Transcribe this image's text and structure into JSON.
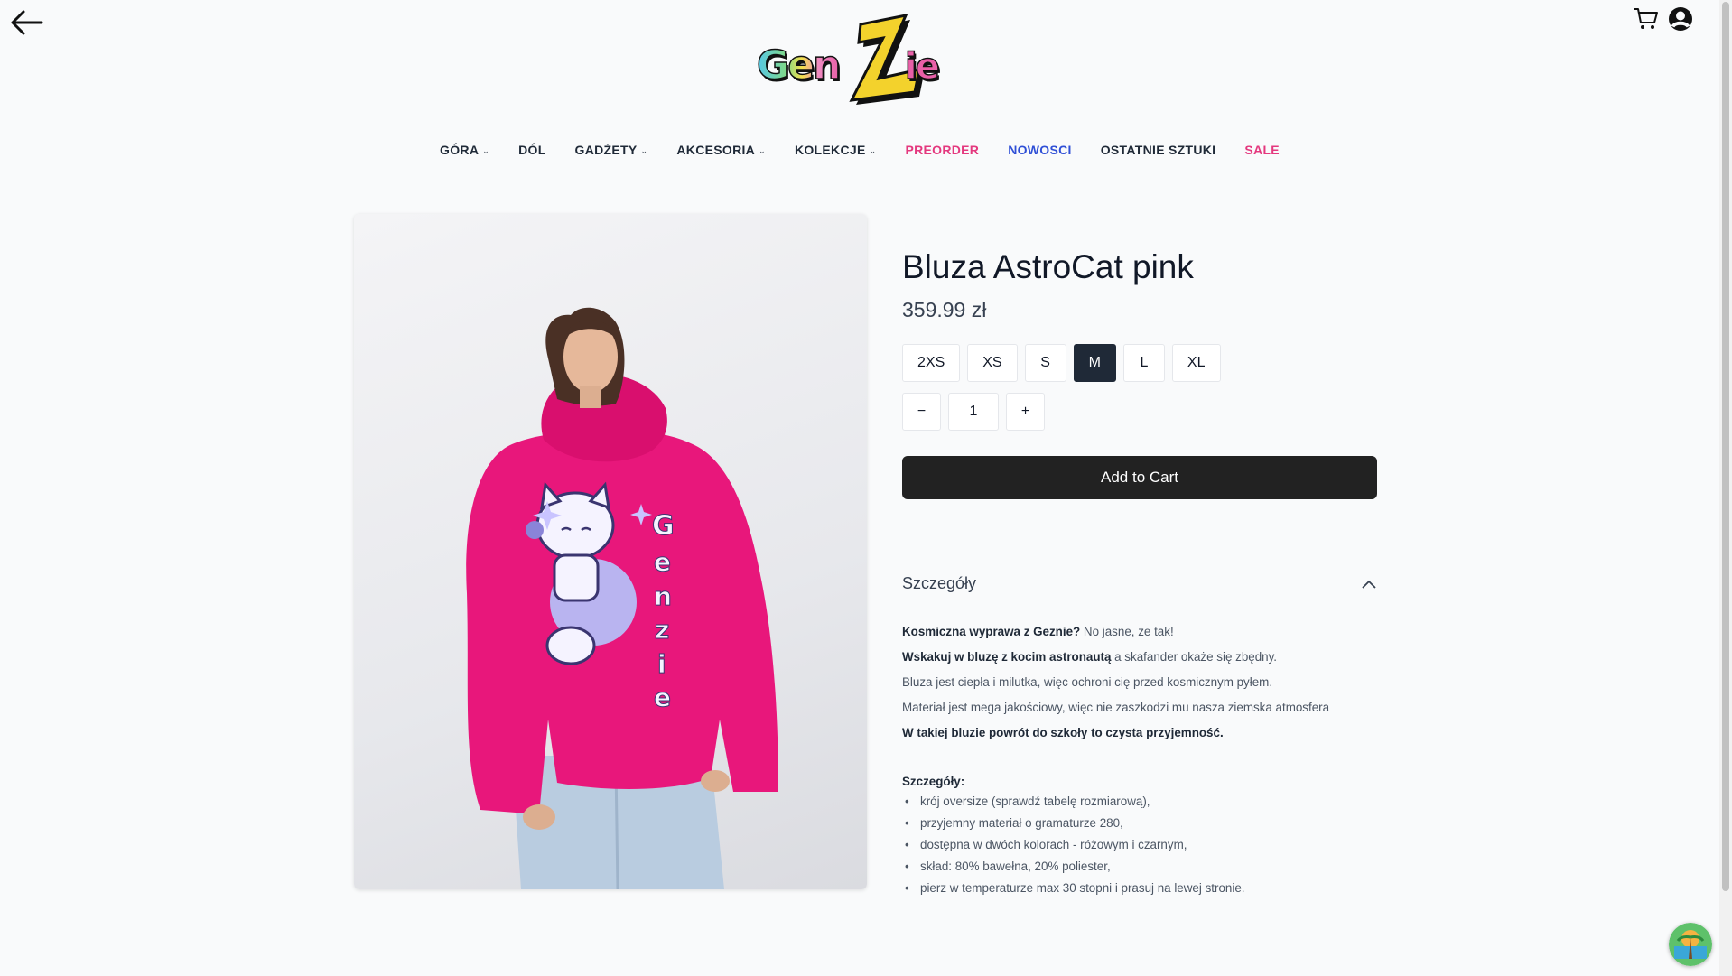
{
  "header": {
    "logo_text": "Genzie",
    "icons": [
      "arrow-left-icon",
      "cart-icon",
      "user-circle-icon"
    ]
  },
  "nav": {
    "items": [
      {
        "label": "GÓRA",
        "dropdown": true,
        "color": "#1f2937"
      },
      {
        "label": "DÓL",
        "dropdown": false,
        "color": "#1f2937"
      },
      {
        "label": "GADŻETY",
        "dropdown": true,
        "color": "#1f2937"
      },
      {
        "label": "AKCESORIA",
        "dropdown": true,
        "color": "#1f2937"
      },
      {
        "label": "KOLEKCJE",
        "dropdown": true,
        "color": "#1f2937"
      },
      {
        "label": "PREORDER",
        "dropdown": false,
        "color": "#e4387e"
      },
      {
        "label": "NOWOSCI",
        "dropdown": false,
        "color": "#2f4fd6"
      },
      {
        "label": "OSTATNIE SZTUKI",
        "dropdown": false,
        "color": "#1f2937"
      },
      {
        "label": "SALE",
        "dropdown": false,
        "color": "#e4387e"
      }
    ]
  },
  "product": {
    "title": "Bluza AstroCat pink",
    "price": "359.99 zł",
    "sizes": [
      "2XS",
      "XS",
      "S",
      "M",
      "L",
      "XL"
    ],
    "selected_size": "M",
    "quantity": {
      "minus": "−",
      "value": "1",
      "plus": "+"
    },
    "add_to_cart": "Add to Cart",
    "image_alt": "Model wearing pink AstroCat hoodie"
  },
  "details": {
    "heading": "Szczegóły",
    "lines": [
      {
        "bold": "Kosmiczna wyprawa z Geznie?",
        "rest": " No jasne, że tak!"
      },
      {
        "bold": "Wskakuj w bluzę z kocim astronautą",
        "rest": " a skafander okaże się zbędny."
      },
      {
        "bold": "",
        "rest": "Bluza jest ciepła i milutka, więc ochroni cię przed kosmicznym pyłem."
      },
      {
        "bold": "",
        "rest": "Materiał jest mega jakościowy, więc nie zaszkodzi mu nasza ziemska atmosfera"
      },
      {
        "bold": "W takiej bluzie powrót do szkoły to czysta przyjemność.",
        "rest": ""
      }
    ],
    "spec_title": "Szczegóły:",
    "specs": [
      "krój oversize (sprawdź tabelę rozmiarową),",
      "przyjemny materiał o gramaturze 280,",
      "dostępna w dwóch kolorach - różowym i czarnym,",
      "skład: 80% bawełna, 20% poliester,",
      "pierz w temperaturze max 30 stopni i prasuj na lewej stronie."
    ]
  },
  "colors": {
    "button_dark": "#222222",
    "accent_pink": "#e4387e",
    "accent_blue": "#2f4fd6",
    "hoodie_pink": "#e8177b"
  }
}
